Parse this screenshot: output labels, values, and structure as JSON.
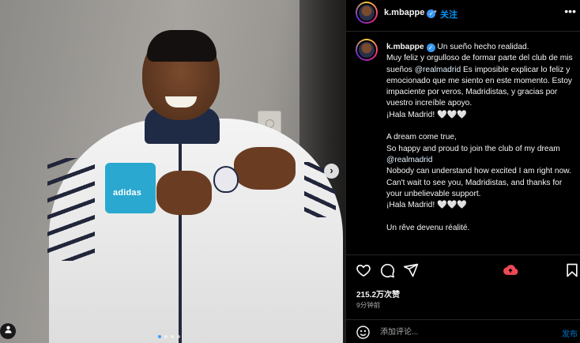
{
  "header": {
    "username": "k.mbappe",
    "verified_mark": "✓",
    "separator": "•",
    "follow_label": "关注",
    "more_label": "•••"
  },
  "caption": {
    "username": "k.mbappe",
    "lines": [
      "Un sueño hecho realidad.",
      "Muy feliz y orgulloso de formar parte del club de mis sueños",
      "@realmadrid",
      "Es imposible explicar lo feliz y emocionado que me siento en este momento. Estoy impaciente por veros, Madridistas, y gracias por vuestro increíble apoyo.",
      "¡Hala Madrid! 🤍🤍🤍",
      "A dream come true,",
      "So happy and proud to join the club of my dream",
      "@realmadrid",
      "Nobody can understand how excited I am right now.",
      "Can't wait to see you, Madridistas, and thanks for your unbelievable support.",
      "¡Hala Madrid! 🤍🤍🤍",
      "Un rêve devenu réalité."
    ]
  },
  "media": {
    "next_label": "›",
    "user_tag_icon": "user-icon",
    "carousel_count": 4,
    "carousel_active": 0
  },
  "actions": {
    "like_icon": "heart-icon",
    "comment_icon": "comment-icon",
    "share_icon": "share-icon",
    "extra_icon": "share-alert-icon",
    "save_icon": "bookmark-icon",
    "extra_color": "#ed4956"
  },
  "stats": {
    "likes": "215.2万次赞",
    "time_ago": "9分钟前"
  },
  "comment": {
    "placeholder": "添加评论...",
    "post_label": "发布"
  },
  "colors": {
    "accent": "#0095f6",
    "verified": "#3897f0",
    "background": "#000000"
  }
}
